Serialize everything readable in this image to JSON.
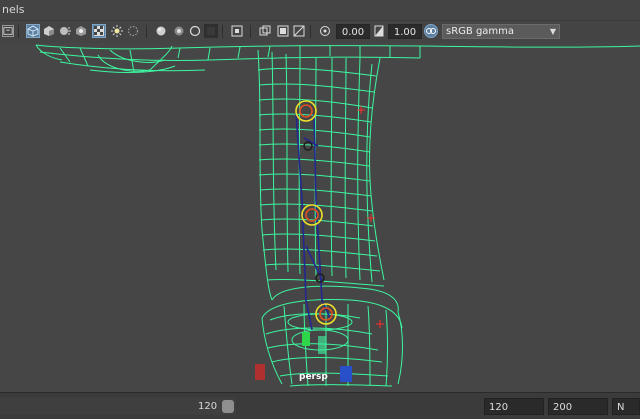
{
  "menubar": {
    "label": "nels"
  },
  "toolbar": {
    "icons": [
      "image-plane-icon",
      "camera-attributes-icon",
      "wireframe-icon",
      "smooth-shade-icon",
      "textured-icon",
      "lights-icon",
      "shadows-icon",
      "ambient-occlusion-icon",
      "isolate-icon",
      "xray-icon",
      "xray-joints-icon",
      "backface-icon",
      "grid-icon",
      "film-gate-icon",
      "resolution-gate-icon",
      "gate-mask-icon",
      "field-chart-icon",
      "safe-action-icon",
      "exposure-icon",
      "gamma-icon",
      "color-management-icon"
    ],
    "exposure_value": "0.00",
    "gamma_value": "1.00",
    "color_space": "sRGB gamma"
  },
  "viewport": {
    "camera_label": "persp",
    "mesh_color": "#3df7a0",
    "joint_color": "#f0e02a",
    "bone_color": "#2a2f9e"
  },
  "timebar": {
    "current_frame": "120",
    "end_frame": "120",
    "anim_end": "200",
    "extra_label": "N"
  }
}
